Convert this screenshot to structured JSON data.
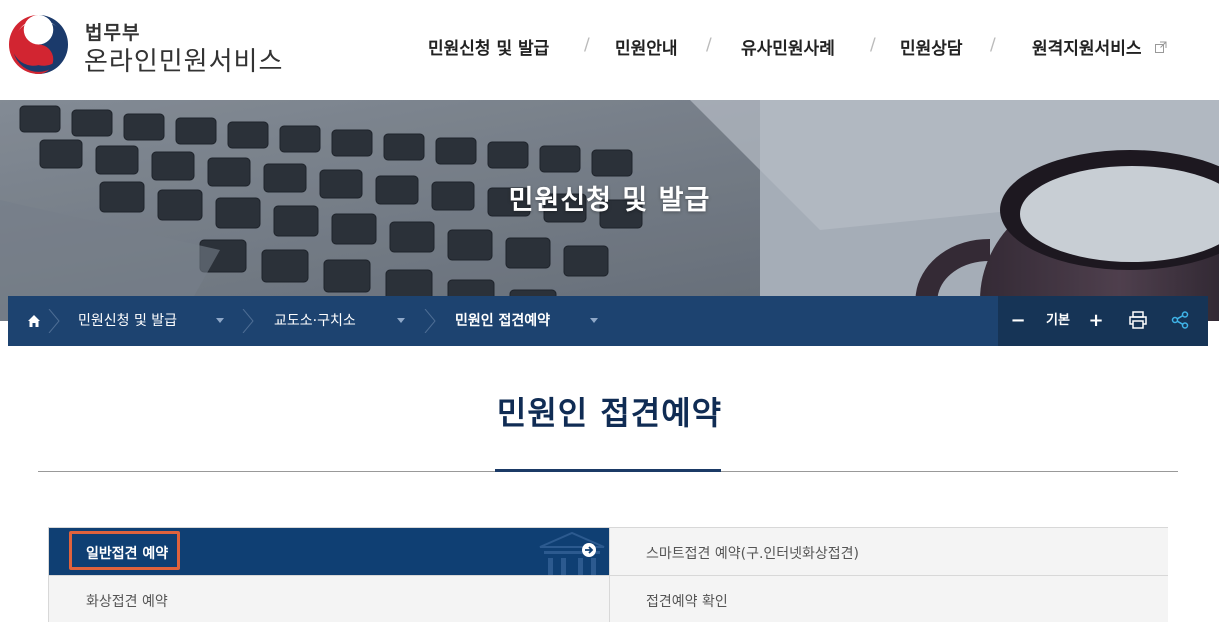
{
  "header": {
    "logo_sub": "법무부",
    "logo_main": "온라인민원서비스",
    "nav": [
      {
        "label": "민원신청 및 발급"
      },
      {
        "label": "민원안내"
      },
      {
        "label": "유사민원사례"
      },
      {
        "label": "민원상담"
      },
      {
        "label": "원격지원서비스",
        "icon": "external-link-icon"
      }
    ],
    "separator": "/"
  },
  "hero": {
    "title": "민원신청 및 발급"
  },
  "breadcrumb": {
    "home_icon": "home-icon",
    "items": [
      {
        "label": "민원신청 및 발급"
      },
      {
        "label": "교도소·구치소"
      },
      {
        "label": "민원인 접견예약"
      }
    ]
  },
  "toolbar": {
    "zoom_out": "−",
    "zoom_label": "기본",
    "zoom_in": "+",
    "print_icon": "print-icon",
    "share_icon": "share-icon"
  },
  "page": {
    "title": "민원인 접견예약"
  },
  "tabs": [
    {
      "label": "일반접견 예약",
      "active": true
    },
    {
      "label": "스마트접견 예약(구.인터넷화상접견)",
      "active": false
    },
    {
      "label": "화상접견 예약",
      "active": false
    },
    {
      "label": "접견예약 확인",
      "active": false
    }
  ],
  "colors": {
    "brand_navy": "#1d4370",
    "active_tab": "#0f3f73",
    "highlight": "#e0623c"
  }
}
